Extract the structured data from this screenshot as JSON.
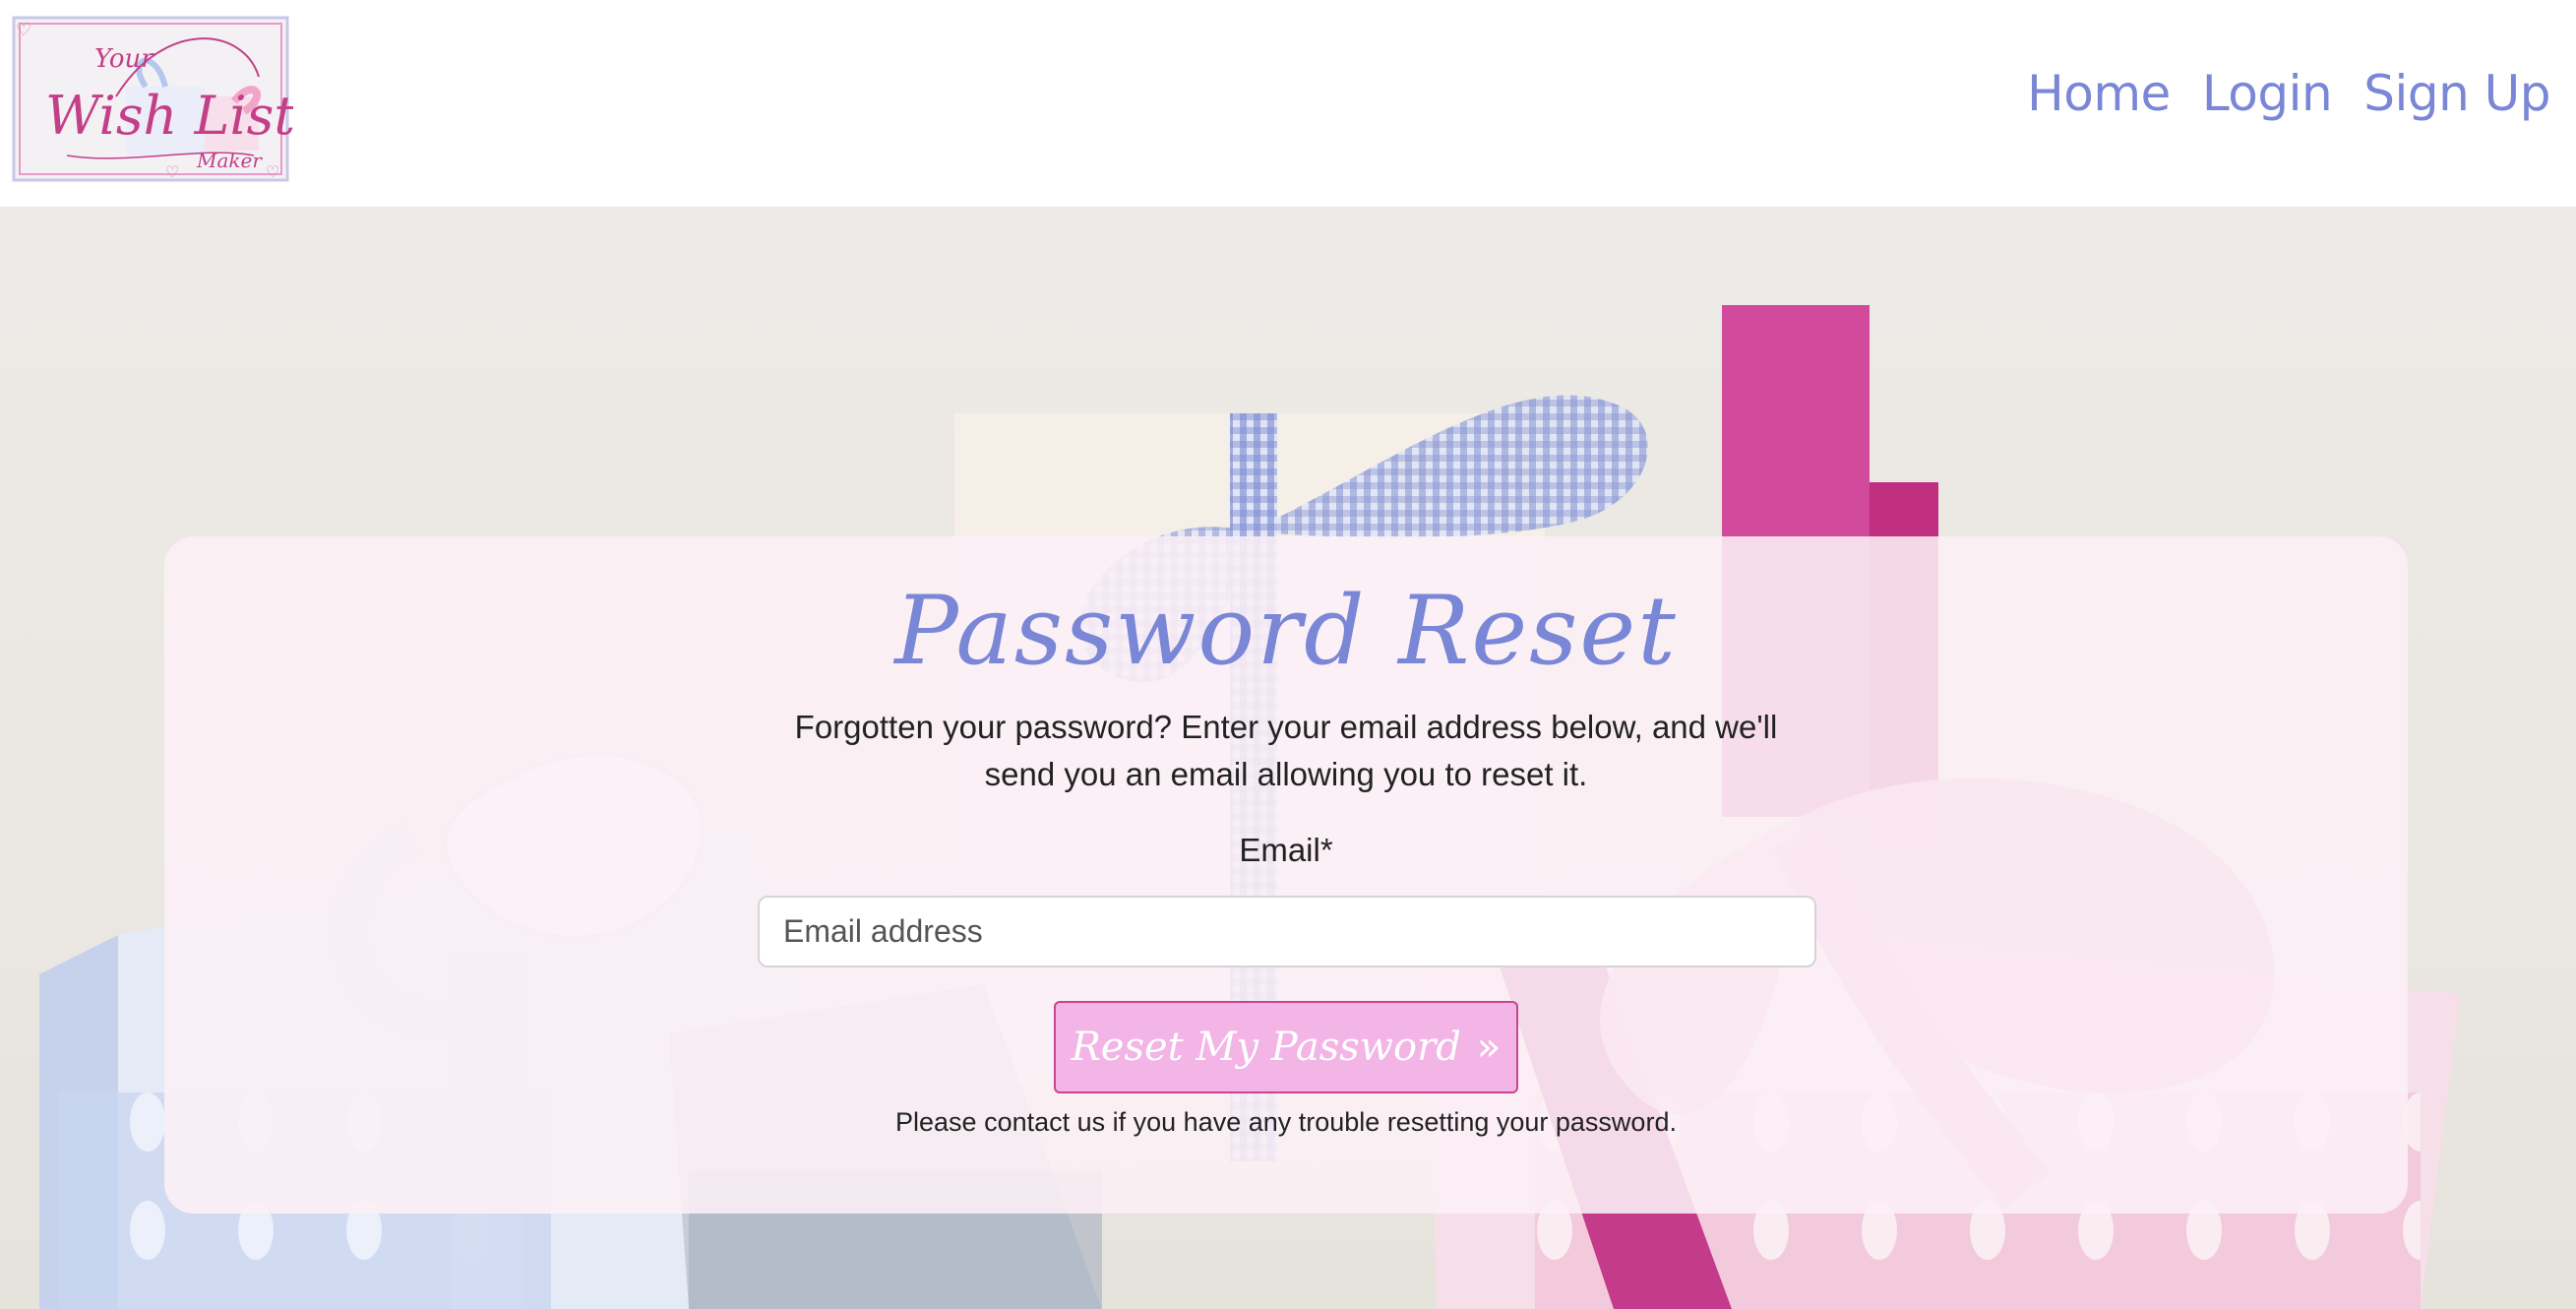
{
  "app": {
    "logo_text": {
      "line1": "Your",
      "line2": "Wish List",
      "line3": "Maker"
    }
  },
  "nav": {
    "items": [
      {
        "label": "Home"
      },
      {
        "label": "Login"
      },
      {
        "label": "Sign Up"
      }
    ]
  },
  "reset": {
    "title": "Password Reset",
    "intro": "Forgotten your password? Enter your email address below, and we'll send you an email allowing you to reset it.",
    "email_label": "Email*",
    "email_placeholder": "Email address",
    "email_value": "",
    "button_label": "Reset My Password",
    "button_icon": "double-chevron-right-icon",
    "note": "Please contact us if you have any trouble resetting your password."
  },
  "colors": {
    "accent": "#7a86d6",
    "button_bg": "#f2b5e5",
    "button_border": "#c9458f"
  }
}
